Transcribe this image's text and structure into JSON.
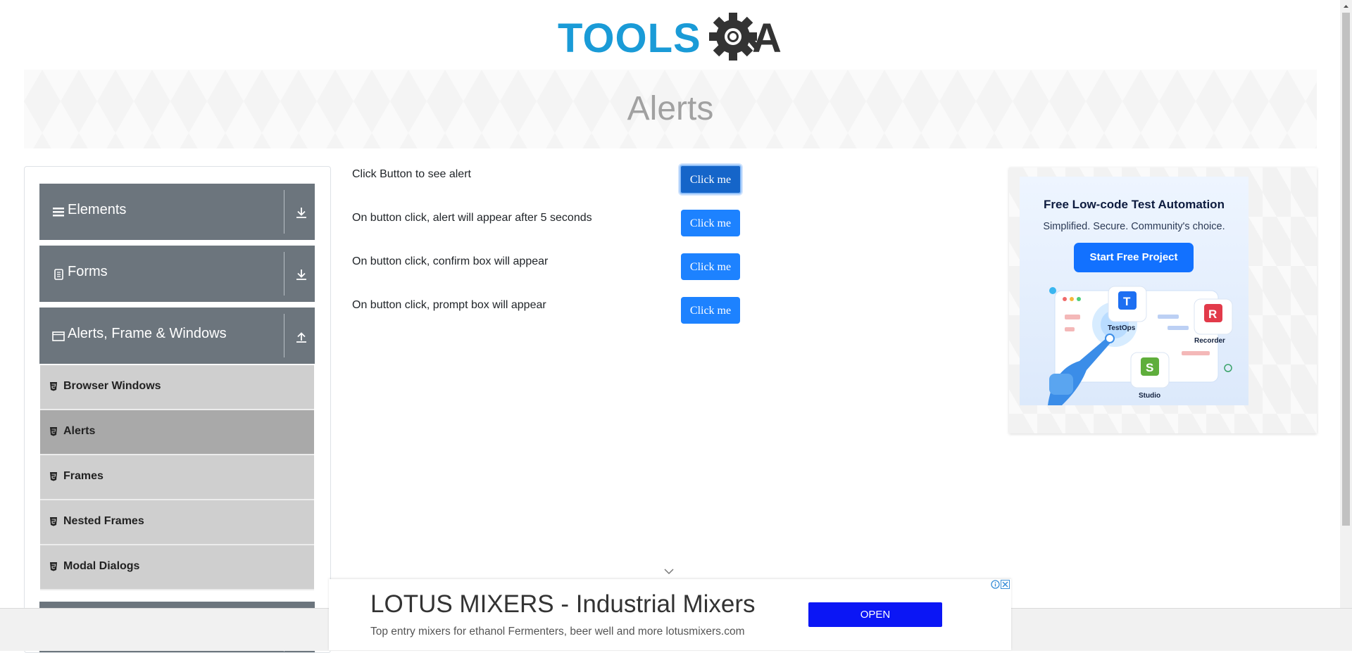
{
  "header": {
    "logo_alt": "TOOLSQA",
    "page_title": "Alerts"
  },
  "sidebar": {
    "groups": [
      {
        "label": "Elements",
        "icon": "hamburger-icon",
        "arrow": "download-arrow-icon"
      },
      {
        "label": "Forms",
        "icon": "form-icon",
        "arrow": "download-arrow-icon"
      },
      {
        "label": "Alerts, Frame & Windows",
        "icon": "window-icon",
        "arrow": "upload-arrow-icon"
      }
    ],
    "items": [
      {
        "label": "Browser Windows",
        "active": false
      },
      {
        "label": "Alerts",
        "active": true
      },
      {
        "label": "Frames",
        "active": false
      },
      {
        "label": "Nested Frames",
        "active": false
      },
      {
        "label": "Modal Dialogs",
        "active": false
      }
    ]
  },
  "main": {
    "rows": [
      {
        "text": "Click Button to see alert",
        "button": "Click me"
      },
      {
        "text": "On button click, alert will appear after 5 seconds",
        "button": "Click me"
      },
      {
        "text": "On button click, confirm box will appear",
        "button": "Click me"
      },
      {
        "text": "On button click, prompt box will appear",
        "button": "Click me"
      }
    ]
  },
  "side_ad": {
    "headline": "Free Low-code Test Automation",
    "subtitle": "Simplified. Secure. Community's choice.",
    "cta": "Start Free Project",
    "labels": {
      "testops": "TestOps",
      "recorder": "Recorder",
      "studio": "Studio"
    },
    "accent": "#1271ff"
  },
  "bottom_ad": {
    "title": "LOTUS MIXERS - Industrial Mixers",
    "description": "Top entry mixers for ethanol Fermenters, beer well and more lotusmixers.com",
    "cta": "OPEN",
    "cta_color": "#0b16f5"
  },
  "colors": {
    "sidebar_group": "#6c757d",
    "sidebar_item": "#cfcfcf",
    "sidebar_item_active": "#a9a9a9",
    "button": "#1d82ff",
    "logo_blue": "#1a9bd7",
    "logo_dark": "#333333"
  }
}
